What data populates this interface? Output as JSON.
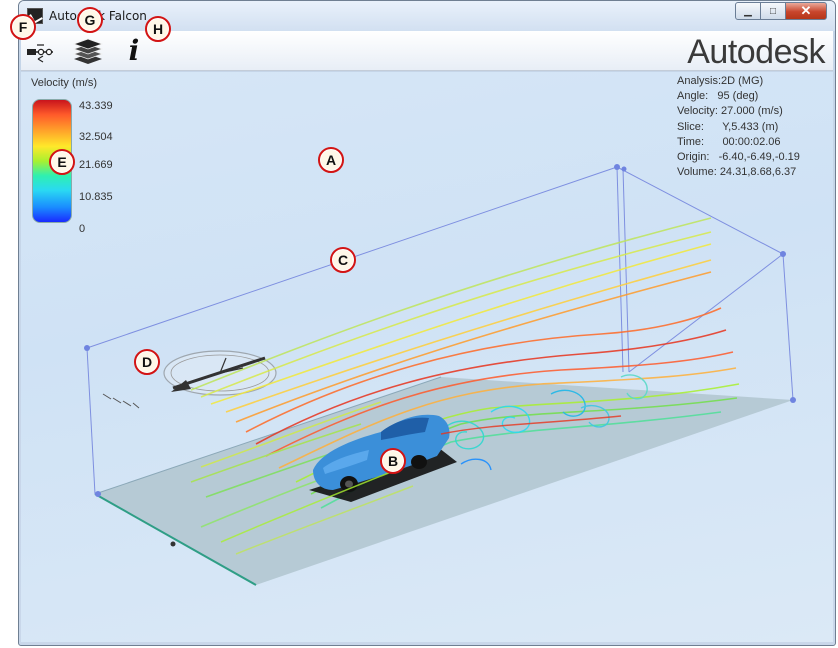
{
  "window": {
    "title": "Autodesk Falcon",
    "controls": {
      "minimize": "▁",
      "maximize": "□",
      "close": "✕"
    }
  },
  "toolbar": {
    "settings_icon": "settings-icon",
    "layers_icon": "layers-icon",
    "info_label": "i",
    "brand": "Autodesk"
  },
  "legend": {
    "title": "Velocity (m/s)",
    "ticks": [
      "43.339",
      "32.504",
      "21.669",
      "10.835",
      "0"
    ]
  },
  "stats": [
    {
      "label": "Analysis:",
      "value": "2D (MG)"
    },
    {
      "label": "Angle:",
      "value": "95 (deg)"
    },
    {
      "label": "Velocity:",
      "value": "27.000 (m/s)"
    },
    {
      "label": "Slice:",
      "value": "Y,5.433 (m)"
    },
    {
      "label": "Time:",
      "value": "00:00:02.06"
    },
    {
      "label": "Origin:",
      "value": "-6.40,-6.49,-0.19"
    },
    {
      "label": "Volume:",
      "value": "24.31,8.68,6.37"
    }
  ],
  "markers": {
    "A": "A",
    "B": "B",
    "C": "C",
    "D": "D",
    "E": "E",
    "F": "F",
    "G": "G",
    "H": "H"
  },
  "colors": {
    "accent_red": "#d21414",
    "flow_red": "#e8331c",
    "flow_orange": "#ff9c2a",
    "flow_yellow": "#f3e93a",
    "flow_green": "#8ee64a",
    "flow_cyan": "#2fd8d0",
    "car_blue": "#3b8fd9"
  }
}
